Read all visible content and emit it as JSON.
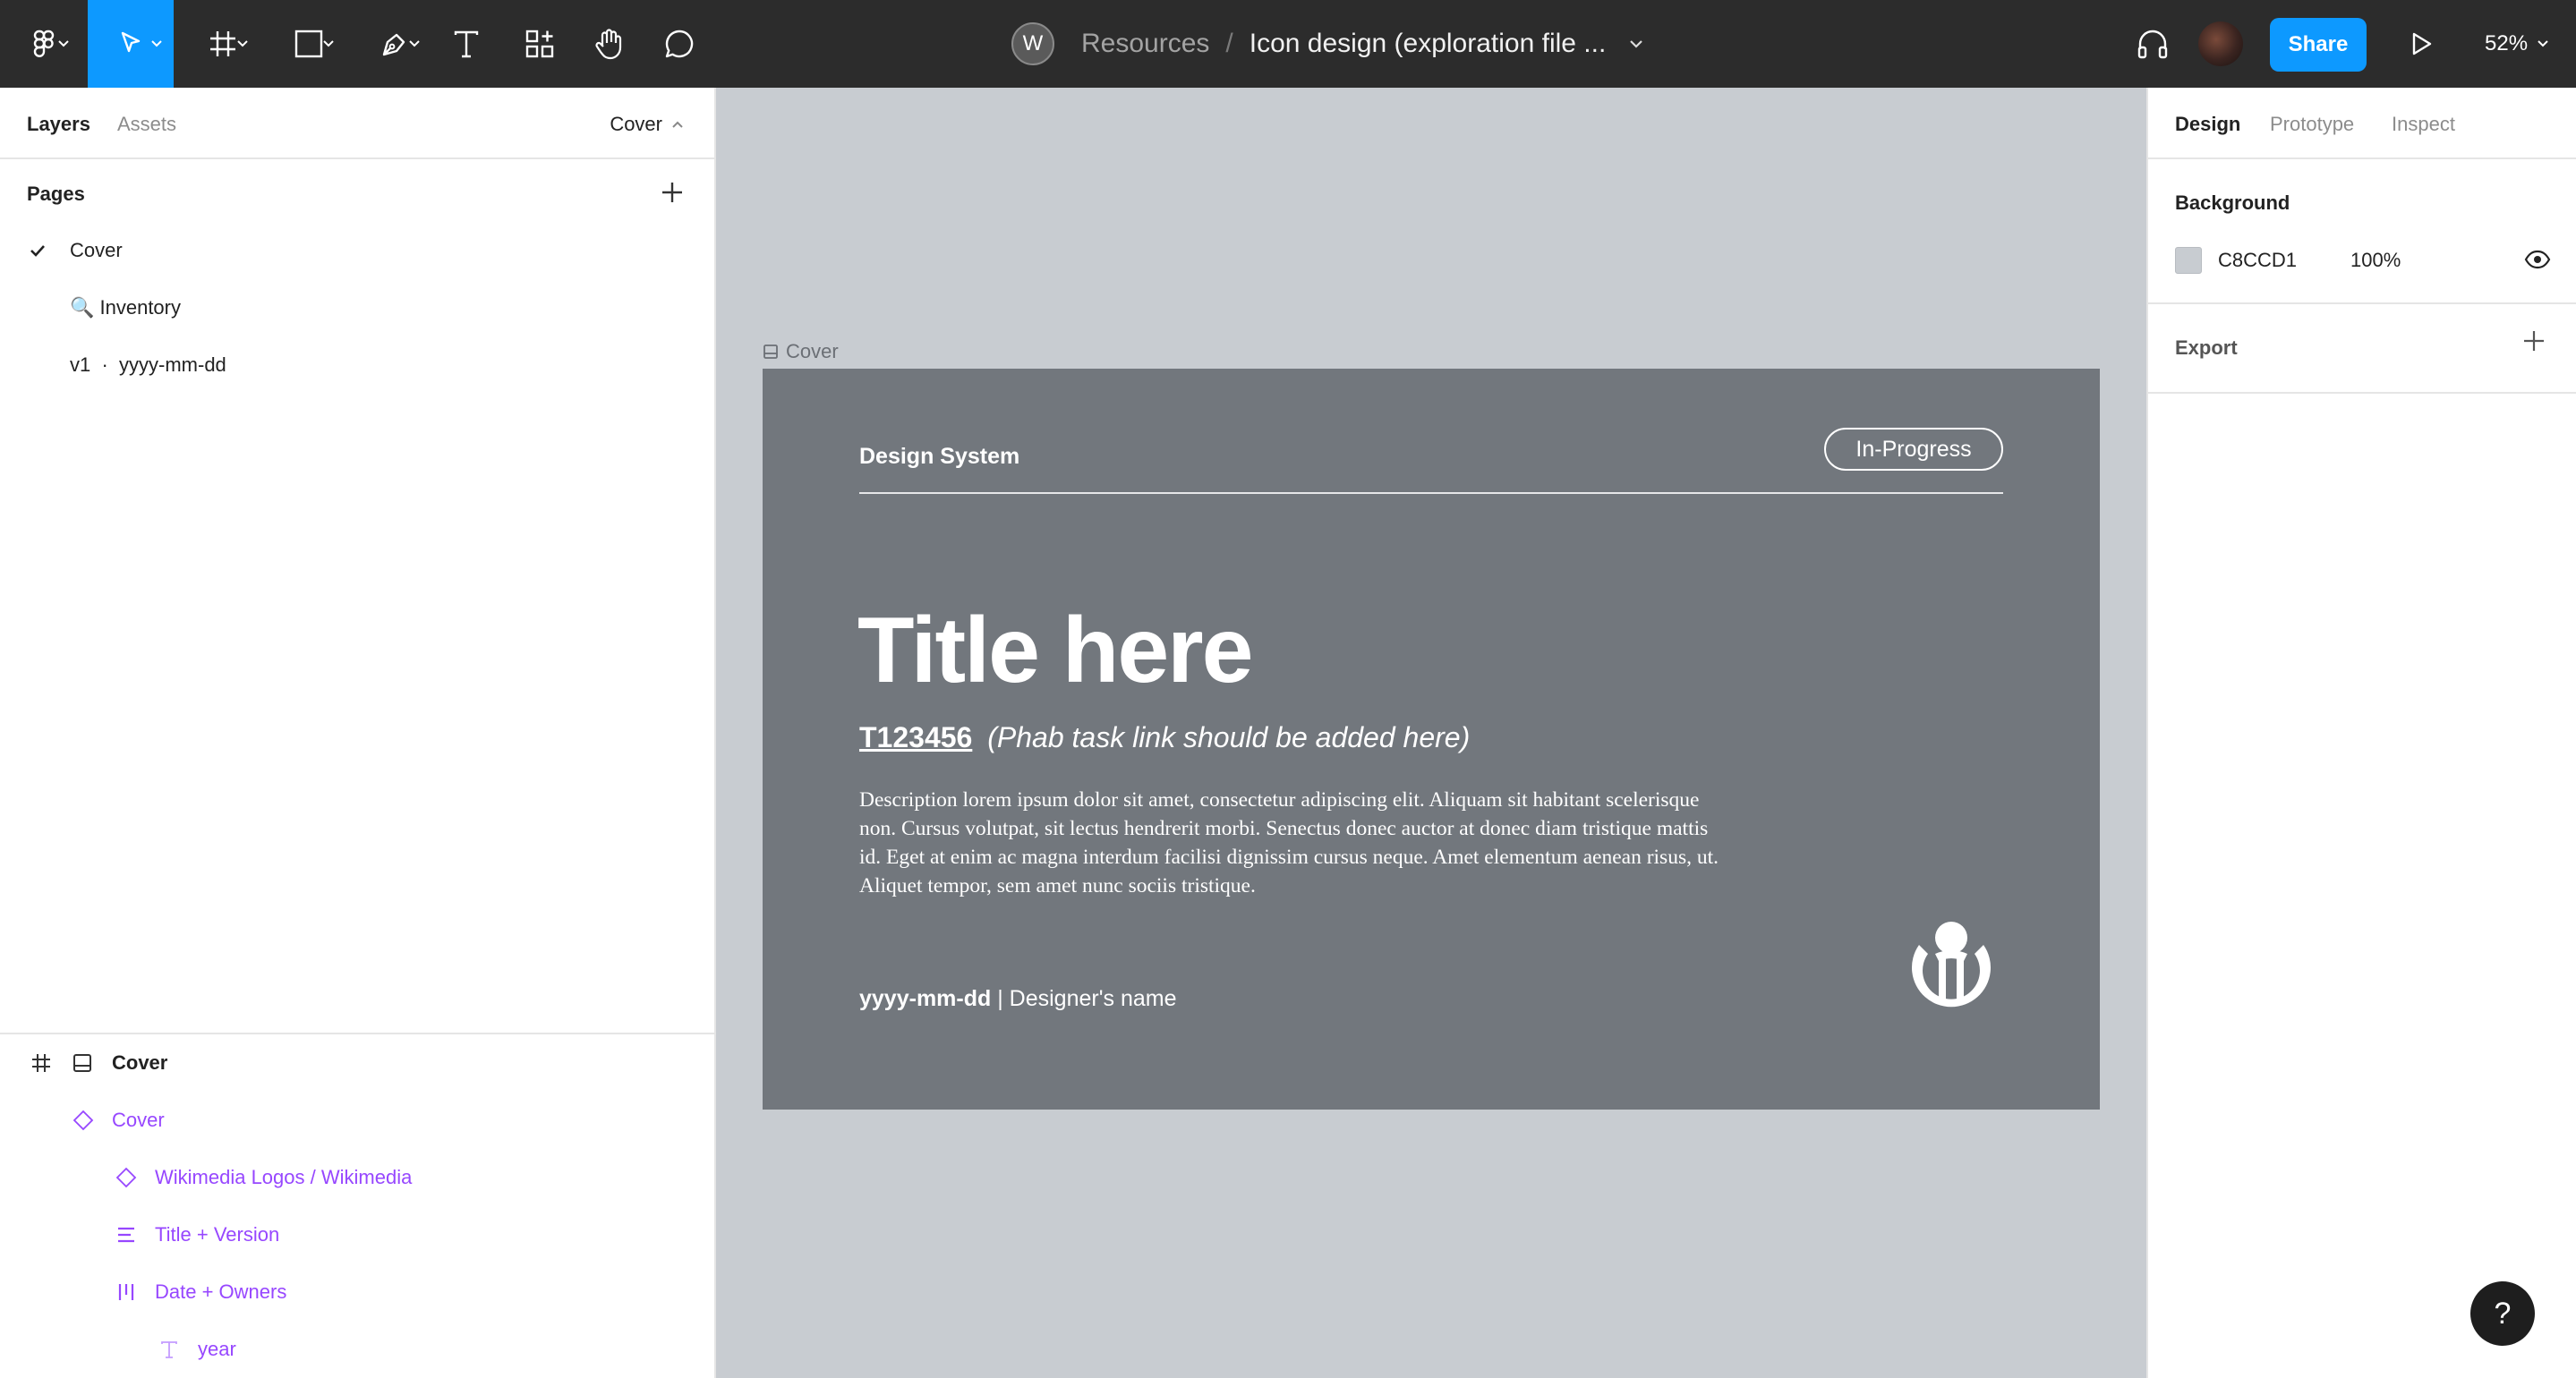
{
  "toolbar": {
    "team_initial": "W",
    "project": "Resources",
    "separator": "/",
    "file_name": "Icon design (exploration file ...",
    "share_label": "Share",
    "zoom": "52%",
    "tools": [
      "figma-menu-icon",
      "move-tool-icon",
      "frame-tool-icon",
      "shape-tool-icon",
      "pen-tool-icon",
      "text-tool-icon",
      "resources-icon",
      "hand-tool-icon",
      "comment-icon"
    ],
    "active_tool": "move-tool-icon",
    "accent_color": "#0d99ff"
  },
  "left_panel": {
    "tabs": [
      "Layers",
      "Assets"
    ],
    "current_page": "Cover",
    "pages_title": "Pages",
    "pages": [
      {
        "label": "Cover",
        "selected": true
      },
      {
        "label": "🔍 Inventory",
        "selected": false
      },
      {
        "label": "v1  ·  yyyy-mm-dd",
        "selected": false
      }
    ],
    "layers": [
      {
        "label": "Cover",
        "icon": "frame-icon",
        "style": "frame"
      },
      {
        "label": "Cover",
        "icon": "component-icon",
        "style": "component"
      },
      {
        "label": "Wikimedia Logos / Wikimedia",
        "icon": "instance-icon",
        "style": "component"
      },
      {
        "label": "Title + Version",
        "icon": "autolayout-vertical-icon",
        "style": "component"
      },
      {
        "label": "Date + Owners",
        "icon": "autolayout-horizontal-icon",
        "style": "component"
      },
      {
        "label": "year",
        "icon": "text-layer-icon",
        "style": "component"
      }
    ]
  },
  "canvas": {
    "background": "#c8ccd1",
    "frame_label": "Cover",
    "frame": {
      "background": "#72777d",
      "design_system": "Design System",
      "status_badge": "In-Progress",
      "title": "Title here",
      "task_id": "T123456",
      "task_note": "(Phab task link should be added here)",
      "description": "Description lorem ipsum dolor sit amet, consectetur adipiscing elit. Aliquam sit habitant scelerisque non. Cursus volutpat, sit lectus hendrerit morbi. Senectus donec auctor at donec diam tristique mattis id. Eget at enim ac magna interdum facilisi dignissim cursus neque. Amet elementum aenean risus, ut. Aliquet tempor, sem amet nunc sociis tristique.",
      "date": "yyyy-mm-dd",
      "divider": "|",
      "designer": "Designer's name",
      "logo": "wikimedia-logo-icon"
    }
  },
  "right_panel": {
    "tabs": [
      "Design",
      "Prototype",
      "Inspect"
    ],
    "active_tab": "Design",
    "background_title": "Background",
    "background_hex": "C8CCD1",
    "background_opacity": "100%",
    "export_title": "Export"
  },
  "help_label": "?"
}
